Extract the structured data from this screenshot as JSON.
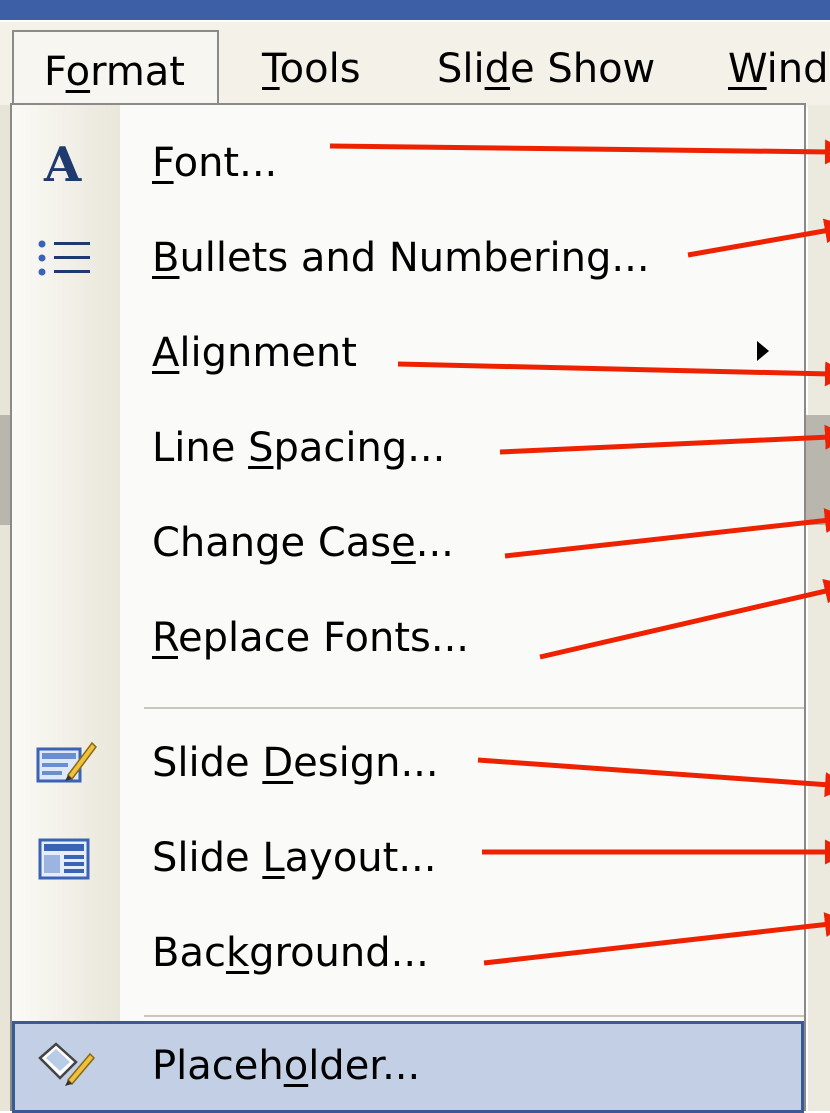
{
  "menubar": {
    "items": [
      {
        "pre": "F",
        "u": "o",
        "post": "rmat"
      },
      {
        "pre": "",
        "u": "T",
        "post": "ools"
      },
      {
        "pre": "Sli",
        "u": "d",
        "post": "e Show"
      },
      {
        "pre": "",
        "u": "W",
        "post": "ind"
      }
    ]
  },
  "format_menu": {
    "items": [
      {
        "pre": "",
        "u": "F",
        "post": "ont...",
        "icon": "font-a-icon"
      },
      {
        "pre": "",
        "u": "B",
        "post": "ullets and Numbering...",
        "icon": "bullets-icon"
      },
      {
        "pre": "",
        "u": "A",
        "post": "lignment",
        "icon": "",
        "submenu": true
      },
      {
        "pre": "Line ",
        "u": "S",
        "post": "pacing...",
        "icon": ""
      },
      {
        "pre": "Change Cas",
        "u": "e",
        "post": "...",
        "icon": ""
      },
      {
        "pre": "",
        "u": "R",
        "post": "eplace Fonts...",
        "icon": ""
      },
      {
        "pre": "Slide ",
        "u": "D",
        "post": "esign...",
        "icon": "slide-design-icon"
      },
      {
        "pre": "Slide ",
        "u": "L",
        "post": "ayout...",
        "icon": "slide-layout-icon"
      },
      {
        "pre": "Bac",
        "u": "k",
        "post": "ground...",
        "icon": ""
      },
      {
        "pre": "Placeh",
        "u": "o",
        "post": "lder...",
        "icon": "placeholder-icon"
      }
    ]
  },
  "colors": {
    "annotation_arrow": "#ee2200",
    "highlight_fill": "#c3cfe4",
    "highlight_border": "#3a5a92"
  }
}
